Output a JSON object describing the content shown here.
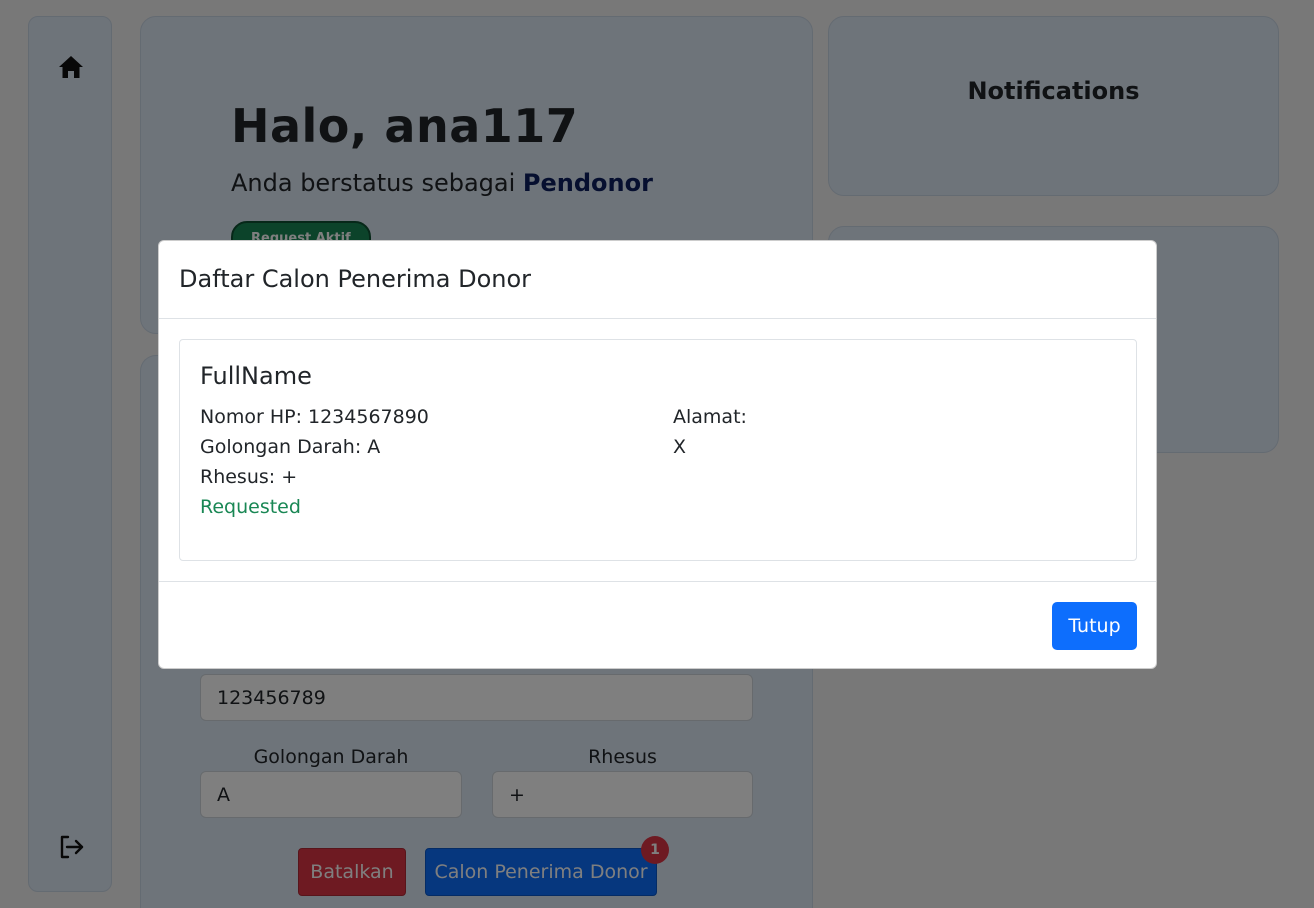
{
  "sidebar": {
    "home_icon": "home-icon",
    "logout_icon": "logout-icon"
  },
  "greeting": {
    "title": "Halo, ana117",
    "status_prefix": "Anda berstatus sebagai ",
    "status_role": "Pendonor",
    "active_badge": "Request Aktif"
  },
  "form": {
    "phone_value": "123456789",
    "blood_type_label": "Golongan Darah",
    "blood_type_value": "A",
    "rhesus_label": "Rhesus",
    "rhesus_value": "+",
    "cancel_label": "Batalkan",
    "candidates_label": "Calon Penerima Donor",
    "candidates_count": "1"
  },
  "notifications": {
    "title": "Notifications"
  },
  "modal": {
    "title": "Daftar Calon Penerima Donor",
    "candidate": {
      "name": "FullName",
      "phone": "Nomor HP: 1234567890",
      "blood_type": "Golongan Darah: A",
      "rhesus": "Rhesus: +",
      "status": "Requested",
      "address_label": "Alamat:",
      "address": "X"
    },
    "close_label": "Tutup"
  },
  "colors": {
    "primary": "#0d6efd",
    "danger": "#dc3545",
    "success": "#198754",
    "card_bg": "#dde8f5"
  }
}
